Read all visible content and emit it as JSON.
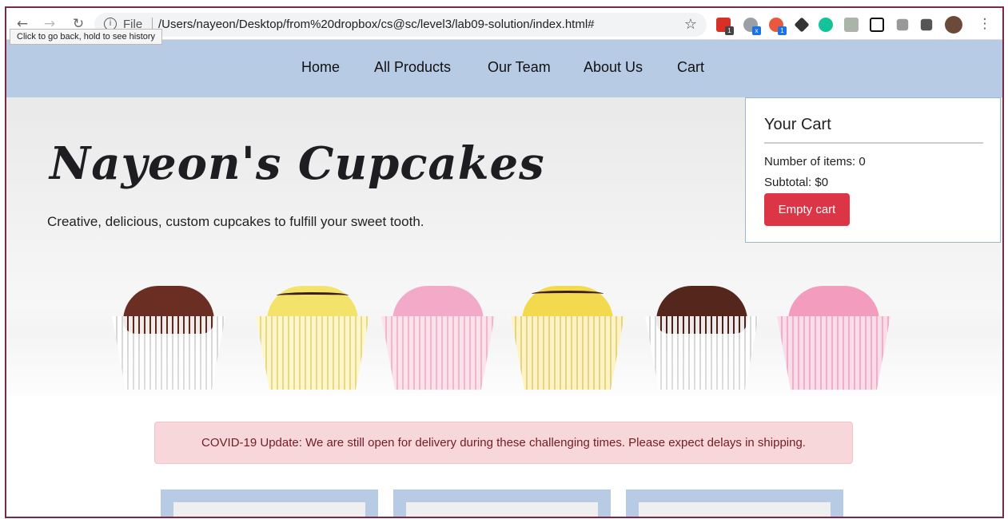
{
  "browser": {
    "scheme": "File",
    "url": "/Users/nayeon/Desktop/from%20dropbox/cs@sc/level3/lab09-solution/index.html#",
    "tooltip": "Click to go back, hold to see history"
  },
  "nav": {
    "items": [
      "Home",
      "All Products",
      "Our Team",
      "About Us",
      "Cart"
    ]
  },
  "hero": {
    "title": "Nayeon's Cupcakes",
    "tagline": "Creative, delicious, custom cupcakes to fulfill your sweet tooth."
  },
  "cart": {
    "title": "Your Cart",
    "items_text": "Number of items: 0",
    "subtotal_label": "Subtotal:",
    "subtotal_value": "$0",
    "empty_button": "Empty cart"
  },
  "alert": {
    "text": "COVID-19 Update: We are still open for delivery during these challenging times. Please expect delays in shipping."
  },
  "colors": {
    "nav_bg": "#b8cbe5",
    "button_danger": "#dc3545",
    "alert_bg": "#f8d7da",
    "alert_text": "#721c24"
  }
}
